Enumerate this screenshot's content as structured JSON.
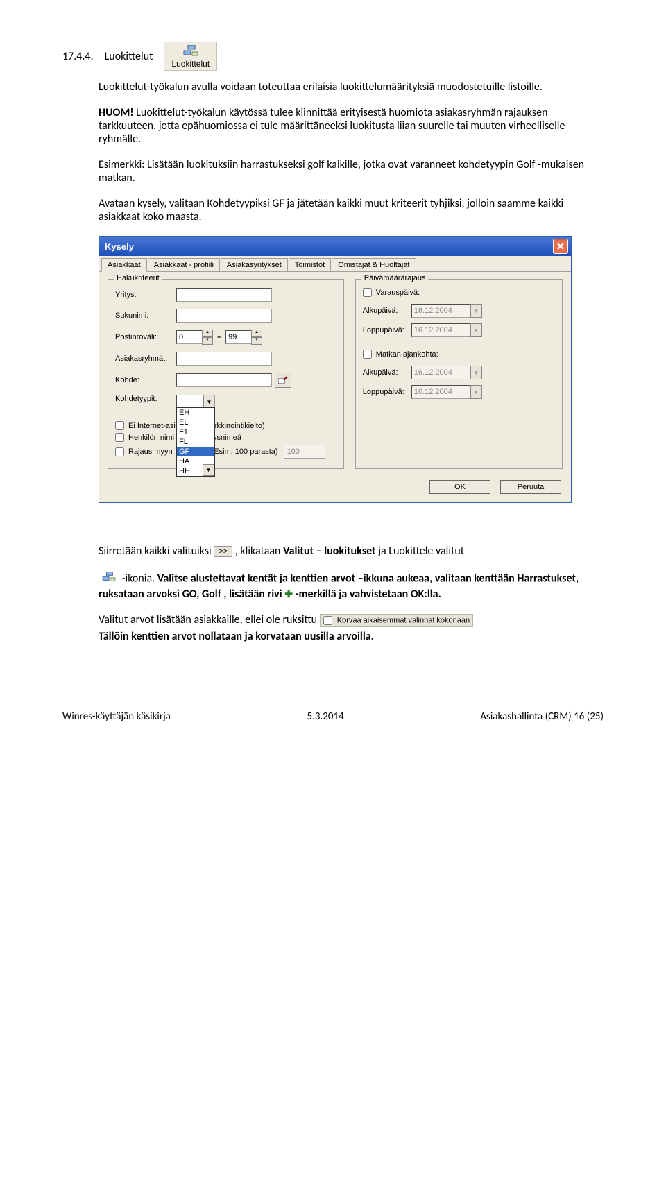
{
  "section": {
    "number": "17.4.4.",
    "title": "Luokittelut",
    "icon_label": "Luokittelut"
  },
  "paragraphs": {
    "p1": "Luokittelut-työkalun avulla voidaan toteuttaa erilaisia luokittelumäärityksiä muodostetuille listoille.",
    "p2a": "HUOM!",
    "p2b": " Luokittelut-työkalun käytössä tulee kiinnittää erityisestä huomiota asiakasryhmän rajauksen tarkkuuteen, jotta epähuomiossa ei tule määrittäneeksi luokitusta liian suurelle tai muuten virheelliselle ryhmälle.",
    "p3": "Esimerkki: Lisätään luokituksiin harrastukseksi golf kaikille, jotka ovat varanneet kohdetyypin Golf -mukaisen matkan.",
    "p4": "Avataan kysely, valitaan Kohdetyypiksi GF ja jätetään kaikki muut kriteerit tyhjiksi, jolloin saamme kaikki asiakkaat koko maasta.",
    "p5a": "Siirretään kaikki valituiksi ",
    "p5b": ", klikataan ",
    "p5c": "Valitut – luokitukset",
    "p5d": " ja Luokittele valitut",
    "p6a": " -ikonia. ",
    "p6b": "Valitse alustettavat kentät ja kenttien arvot –ikkuna aukeaa, valitaan kenttään Harrastukset, ruksataan arvoksi GO, Golf , lisätään rivi ",
    "p6c": "-merkillä ja vahvistetaan OK:lla.",
    "p7": "Valitut arvot lisätään asiakkaille, ellei ole ruksittu ",
    "p8": "Tällöin kenttien arvot nollataan ja korvataan uusilla arvoilla."
  },
  "dialog": {
    "title": "Kysely",
    "tabs": {
      "t1": "Asiakkaat",
      "t2": "Asiakkaat - profiili",
      "t3": "Asiakasyritykset",
      "t4_pre": "T",
      "t4_rest": "oimistot",
      "t5": "Omistajat & Huoltajat"
    },
    "left": {
      "legend": "Hakukriteerit",
      "yritys": "Yritys:",
      "sukunimi": "Sukunimi:",
      "postinrovali": "Postinroväli:",
      "post_from": "0",
      "post_to": "99",
      "asiakasryhmat": "Asiakasryhmät:",
      "kohde": "Kohde:",
      "kohdetyypit": "Kohdetyypit:",
      "kt_selected": "GF",
      "kt_options": [
        "EH",
        "EL",
        "F1",
        "FL",
        "GF",
        "HA",
        "HH"
      ],
      "cb1": "Ei Internet-asi",
      "cb1_suffix": "rkkinointikielto)",
      "cb2": "Henkilön nimi",
      "cb2_suffix": "vsnimeä",
      "cb3": "Rajaus myyn",
      "cb3_suffix": "(Esim. 100 parasta)",
      "cb3_value": "100"
    },
    "right": {
      "legend": "Päivämäärärajaus",
      "varaus": "Varauspäivä:",
      "alku": "Alkupäivä:",
      "loppu": "Loppupäivä:",
      "date": "16.12.2004",
      "matkan": "Matkan ajankohta:"
    },
    "ok": "OK",
    "peruuta": "Peruuta"
  },
  "inline": {
    "move_all": ">>",
    "korvaa": "Korvaa aikaisemmat valinnat kokonaan"
  },
  "footer": {
    "left": "Winres-käyttäjän käsikirja",
    "center": "5.3.2014",
    "right": "Asiakashallinta (CRM)  16 (25)"
  }
}
